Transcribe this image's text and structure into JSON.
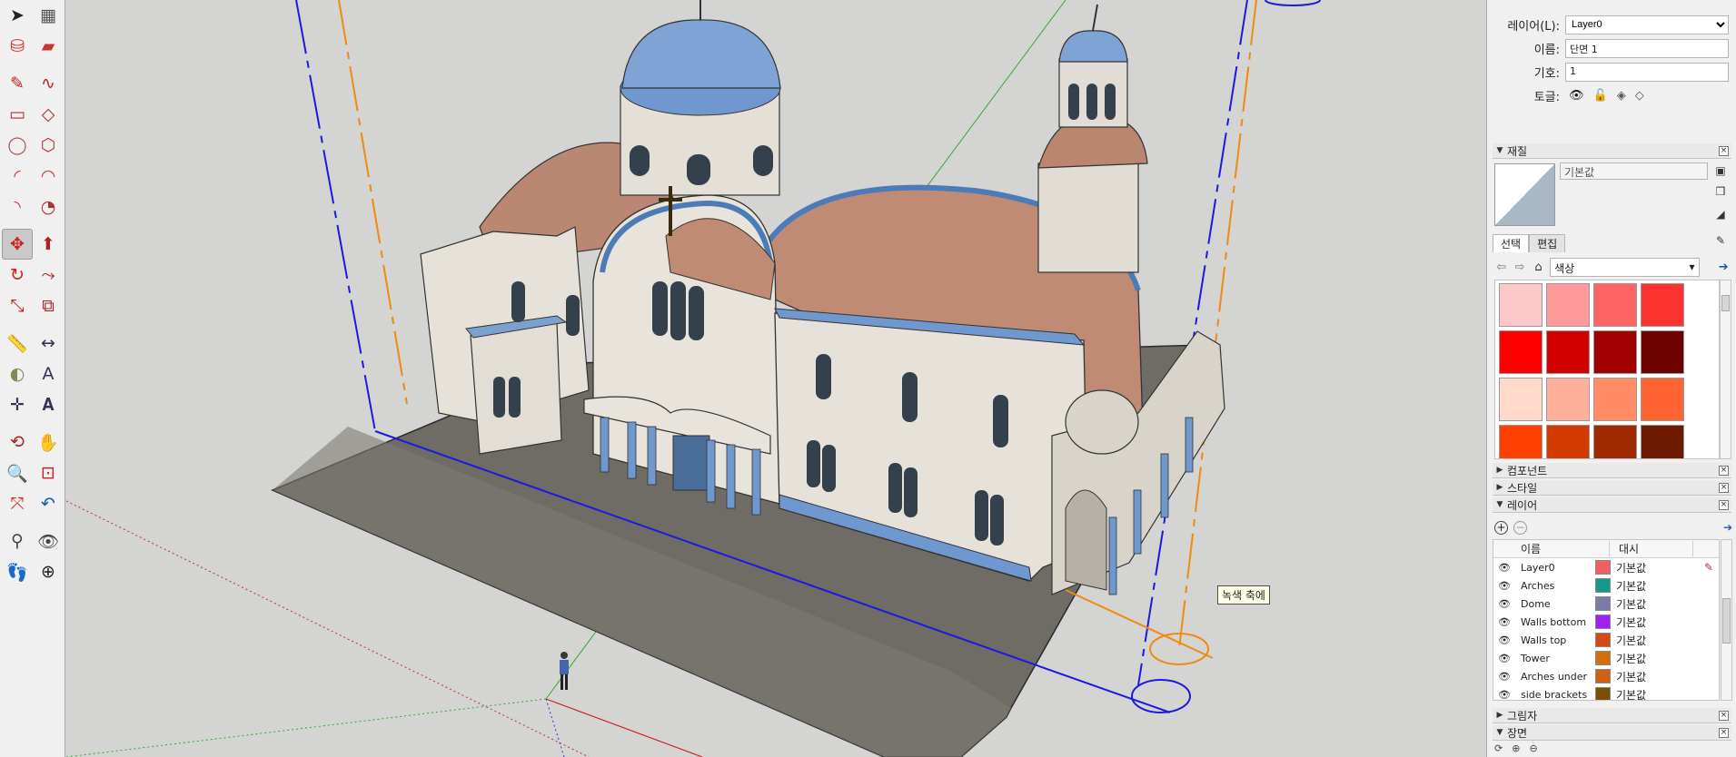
{
  "toolbar": {
    "tools": [
      {
        "name": "select-tool",
        "icon": "arrow-icon",
        "active": false
      },
      {
        "name": "make-component-tool",
        "icon": "component-icon",
        "active": false
      },
      {
        "name": "paint-bucket-tool",
        "icon": "paint-bucket-icon",
        "active": false
      },
      {
        "name": "eraser-tool",
        "icon": "eraser-icon",
        "active": false
      },
      {
        "name": "line-tool",
        "icon": "pencil-icon",
        "active": false
      },
      {
        "name": "freehand-tool",
        "icon": "freehand-icon",
        "active": false
      },
      {
        "name": "rectangle-tool",
        "icon": "rectangle-icon",
        "active": false
      },
      {
        "name": "rotated-rectangle-tool",
        "icon": "rotated-rectangle-icon",
        "active": false
      },
      {
        "name": "circle-tool",
        "icon": "circle-icon",
        "active": false
      },
      {
        "name": "polygon-tool",
        "icon": "polygon-icon",
        "active": false
      },
      {
        "name": "arc-tool",
        "icon": "arc-icon",
        "active": false
      },
      {
        "name": "two-point-arc-tool",
        "icon": "two-point-arc-icon",
        "active": false
      },
      {
        "name": "three-point-arc-tool",
        "icon": "three-point-arc-icon",
        "active": false
      },
      {
        "name": "pie-tool",
        "icon": "pie-icon",
        "active": false
      },
      {
        "name": "move-tool",
        "icon": "move-icon",
        "active": true
      },
      {
        "name": "push-pull-tool",
        "icon": "push-pull-icon",
        "active": false
      },
      {
        "name": "rotate-tool",
        "icon": "rotate-icon",
        "active": false
      },
      {
        "name": "follow-me-tool",
        "icon": "follow-me-icon",
        "active": false
      },
      {
        "name": "scale-tool",
        "icon": "scale-icon",
        "active": false
      },
      {
        "name": "offset-tool",
        "icon": "offset-icon",
        "active": false
      },
      {
        "name": "tape-measure-tool",
        "icon": "tape-measure-icon",
        "active": false
      },
      {
        "name": "dimension-tool",
        "icon": "dimension-icon",
        "active": false
      },
      {
        "name": "protractor-tool",
        "icon": "protractor-icon",
        "active": false
      },
      {
        "name": "text-tool",
        "icon": "text-icon",
        "active": false
      },
      {
        "name": "axes-tool",
        "icon": "axes-icon",
        "active": false
      },
      {
        "name": "3d-text-tool",
        "icon": "3d-text-icon",
        "active": false
      },
      {
        "name": "orbit-tool",
        "icon": "orbit-icon",
        "active": false
      },
      {
        "name": "pan-tool",
        "icon": "hand-icon",
        "active": false
      },
      {
        "name": "zoom-tool",
        "icon": "zoom-icon",
        "active": false
      },
      {
        "name": "zoom-window-tool",
        "icon": "zoom-window-icon",
        "active": false
      },
      {
        "name": "zoom-extents-tool",
        "icon": "zoom-extents-icon",
        "active": false
      },
      {
        "name": "previous-view-tool",
        "icon": "previous-view-icon",
        "active": false
      },
      {
        "name": "position-camera-tool",
        "icon": "position-camera-icon",
        "active": false
      },
      {
        "name": "look-around-tool",
        "icon": "eye-icon",
        "active": false
      },
      {
        "name": "walk-tool",
        "icon": "footprints-icon",
        "active": false
      },
      {
        "name": "section-plane-tool",
        "icon": "section-plane-icon",
        "active": false
      }
    ]
  },
  "viewport": {
    "tooltip": "녹색 축에"
  },
  "entity_info": {
    "layer_label": "레이어(L):",
    "layer_value": "Layer0",
    "name_label": "이름:",
    "name_value": "단면 1",
    "symbol_label": "기호:",
    "symbol_value": "1",
    "toggle_label": "토글:"
  },
  "materials": {
    "title": "재질",
    "name_value": "기본값",
    "tabs": [
      "선택",
      "편집"
    ],
    "library": "색상",
    "swatches": [
      "#ffc8c8",
      "#ff9a9a",
      "#ff6464",
      "#ff3232",
      "#ff0000",
      "#d20000",
      "#a00000",
      "#6e0000",
      "#ffd9c9",
      "#ffb09a",
      "#ff8c64",
      "#ff6432",
      "#ff4000",
      "#d23a00",
      "#a02a00",
      "#6e1a00"
    ]
  },
  "panels": {
    "components": "컴포넌트",
    "styles": "스타일",
    "layers": "레이어",
    "shadows": "그림자",
    "scenes": "장면"
  },
  "layers": {
    "col_name": "이름",
    "col_dash": "대시",
    "rows": [
      {
        "name": "Layer0",
        "color": "#f06060",
        "dash": "기본값",
        "current": true
      },
      {
        "name": "Arches",
        "color": "#16998a",
        "dash": "기본값",
        "current": false
      },
      {
        "name": "Dome",
        "color": "#7b7ba8",
        "dash": "기본값",
        "current": false
      },
      {
        "name": "Walls bottom",
        "color": "#a020f0",
        "dash": "기본값",
        "current": false
      },
      {
        "name": "Walls top",
        "color": "#d24a18",
        "dash": "기본값",
        "current": false
      },
      {
        "name": "Tower",
        "color": "#d27010",
        "dash": "기본값",
        "current": false
      },
      {
        "name": "Arches under",
        "color": "#d26014",
        "dash": "기본값",
        "current": false
      },
      {
        "name": "side brackets",
        "color": "#7a5008",
        "dash": "기본값",
        "current": false
      }
    ]
  }
}
